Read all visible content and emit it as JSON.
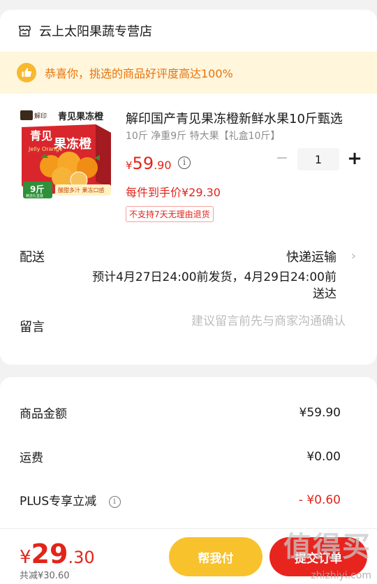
{
  "shop": {
    "name": "云上太阳果蔬专营店"
  },
  "praise_banner": {
    "text": "恭喜你，挑选的商品好评度高达100%"
  },
  "product": {
    "title": "解印国产青见果冻橙新鲜水果10斤甄选",
    "spec": "10斤 净重9斤 特大果【礼盒10斤】",
    "price_currency": "¥",
    "price_int": "59",
    "price_dec": ".90",
    "quantity": "1",
    "minus_label": "−",
    "plus_label": "+",
    "unit_price_text": "每件到手价¥29.30",
    "no_return_tag": "不支持7天无理由退货",
    "image": {
      "brand": "解印",
      "top_label": "青见果冻橙",
      "box_title_1": "青见",
      "box_title_2": "果冻橙",
      "box_en": "Jelly Orange",
      "weight_badge": "9斤",
      "weight_sub": "精选礼盒装",
      "slogan": "酸甜多汁 果冻口感"
    }
  },
  "delivery": {
    "label": "配送",
    "method": "快递运输",
    "line1": "预计4月27日24:00前发货，4月29日24:00前",
    "line2": "送达"
  },
  "note": {
    "label": "留言",
    "placeholder": "建议留言前先与商家沟通确认"
  },
  "summary": {
    "goods_amount_label": "商品金额",
    "goods_amount": "¥59.90",
    "shipping_label": "运费",
    "shipping": "¥0.00",
    "plus_label": "PLUS专享立减",
    "plus_discount": "- ¥0.60"
  },
  "bottom": {
    "currency": "¥",
    "total_int": "29",
    "total_dec": ".30",
    "saved": "共减¥30.60",
    "help_pay": "帮我付",
    "submit": "提交订单"
  },
  "watermark": {
    "logo": "值得买",
    "url": "zhizhiyi.com"
  },
  "colors": {
    "accent_red": "#e1251b",
    "accent_orange": "#f8c22d",
    "banner_bg": "#fff6dc",
    "banner_text": "#e8730c"
  }
}
